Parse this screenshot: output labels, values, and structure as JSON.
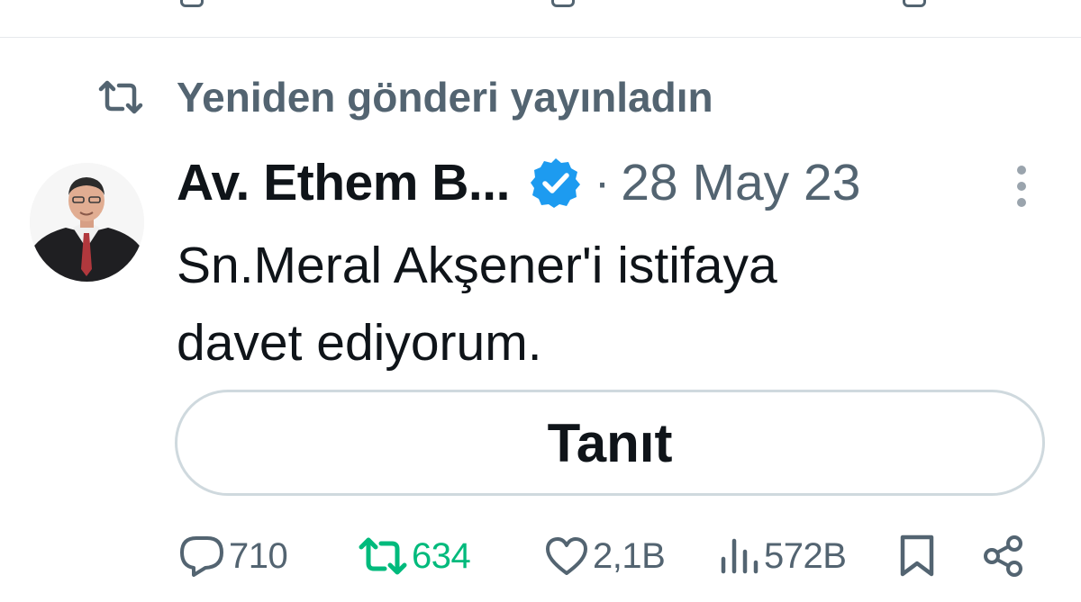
{
  "repost_banner": {
    "text": "Yeniden gönderi yayınladın",
    "icon": "repost-icon"
  },
  "tweet": {
    "author_name": "Av. Ethem B...",
    "verified_icon": "verified-badge-icon",
    "separator": "·",
    "timestamp": "28 May 23",
    "text": "Sn.Meral Akşener'i istifaya\ndavet ediyorum.",
    "avatar_icon": "avatar",
    "more_icon": "more-options-icon"
  },
  "translate_button": {
    "label": "Tanıt"
  },
  "actions": {
    "reply": {
      "count": "710",
      "icon": "reply-icon"
    },
    "repost": {
      "count": "634",
      "icon": "repost-icon",
      "active": true
    },
    "like": {
      "count": "2,1B",
      "icon": "heart-icon"
    },
    "views": {
      "count": "572B",
      "icon": "views-icon"
    },
    "bookmark": {
      "icon": "bookmark-icon"
    },
    "share": {
      "icon": "share-icon"
    }
  },
  "colors": {
    "text_primary": "#0f1419",
    "text_secondary": "#536471",
    "repost_active": "#00ba7c",
    "verified": "#1d9bf0",
    "border": "#cfd9de"
  }
}
